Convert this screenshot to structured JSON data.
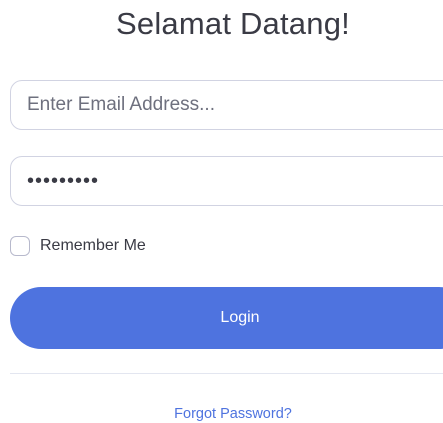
{
  "page": {
    "title": "Selamat Datang!"
  },
  "form": {
    "email_placeholder": "Enter Email Address...",
    "password_value": "•••••••••",
    "remember_label": "Remember Me",
    "login_label": "Login",
    "forgot_label": "Forgot Password?"
  },
  "colors": {
    "primary": "#4e73df",
    "text": "#3a3b45",
    "muted": "#6e707e",
    "border": "#d1d3e2"
  },
  "icons": {
    "checkbox": "checkbox-unchecked"
  }
}
